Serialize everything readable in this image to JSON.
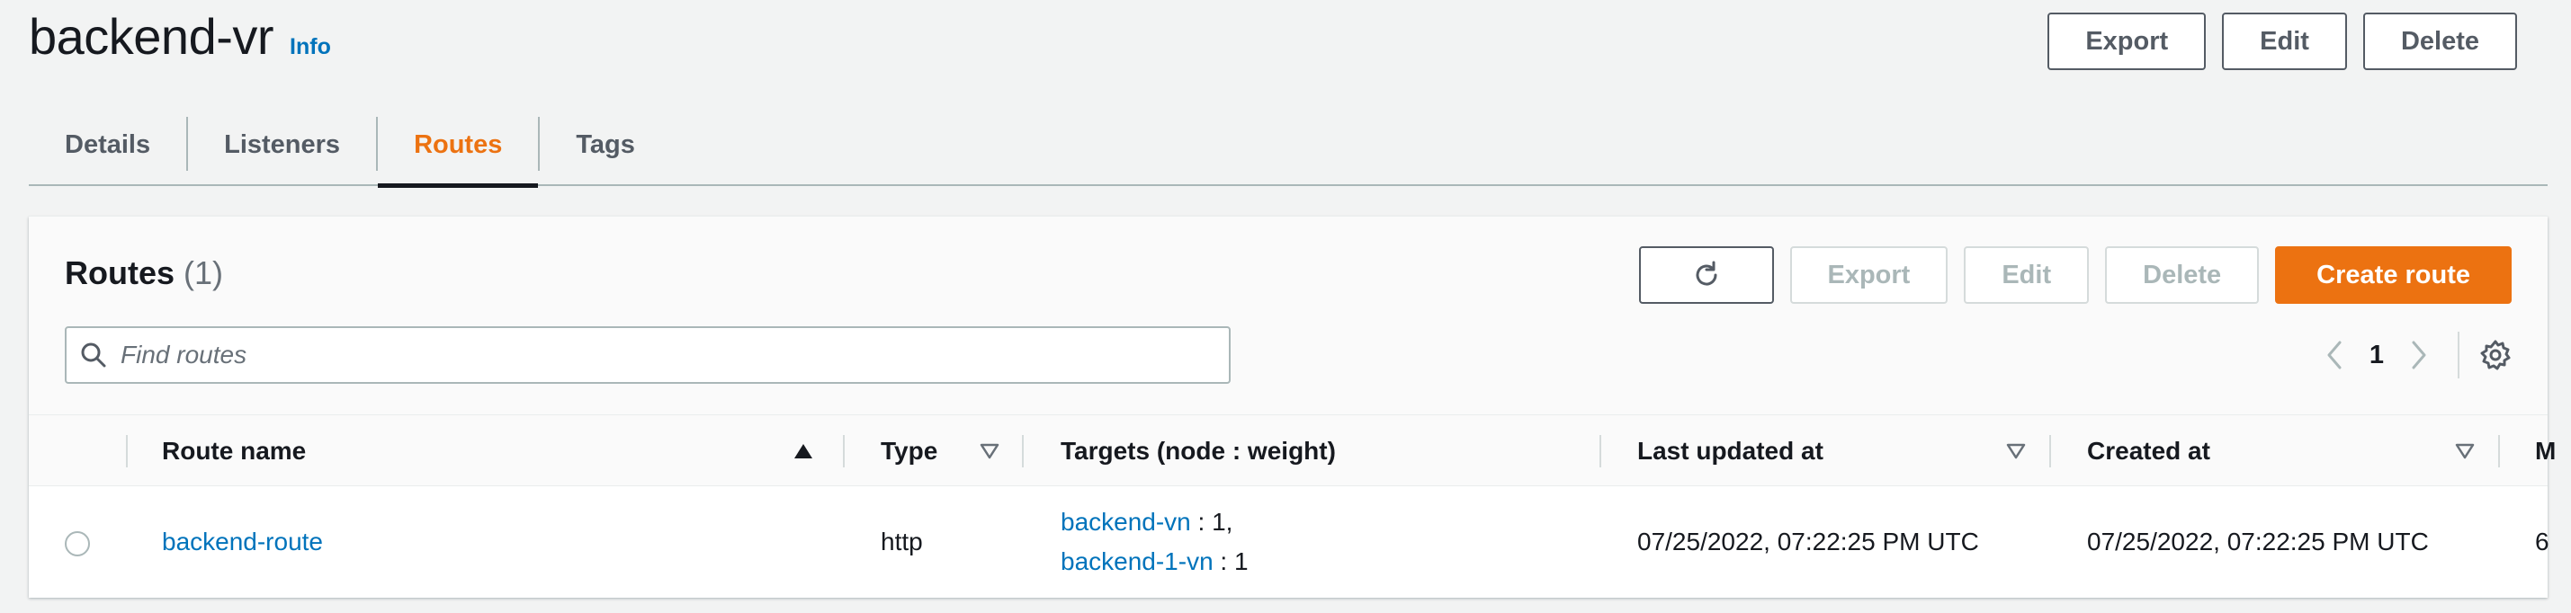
{
  "header": {
    "title": "backend-vr",
    "info_label": "Info",
    "actions": {
      "export": "Export",
      "edit": "Edit",
      "delete": "Delete"
    }
  },
  "tabs": [
    {
      "label": "Details",
      "active": false
    },
    {
      "label": "Listeners",
      "active": false
    },
    {
      "label": "Routes",
      "active": true
    },
    {
      "label": "Tags",
      "active": false
    }
  ],
  "routes_panel": {
    "title": "Routes",
    "count": "(1)",
    "actions": {
      "refresh_icon": "refresh-icon",
      "export": "Export",
      "edit": "Edit",
      "delete": "Delete",
      "create": "Create route"
    },
    "search": {
      "placeholder": "Find routes",
      "value": ""
    },
    "pagination": {
      "current_page": "1"
    },
    "columns": [
      {
        "label": "Route name",
        "sort": "ascending"
      },
      {
        "label": "Type",
        "sort": "none"
      },
      {
        "label": "Targets (node : weight)",
        "sort": null
      },
      {
        "label": "Last updated at",
        "sort": "none"
      },
      {
        "label": "Created at",
        "sort": "none"
      },
      {
        "label": "M",
        "sort": null
      }
    ],
    "rows": [
      {
        "selected": false,
        "route_name": "backend-route",
        "type": "http",
        "targets": [
          {
            "node": "backend-vn",
            "weight": " : 1,"
          },
          {
            "node": "backend-1-vn",
            "weight": " : 1"
          }
        ],
        "last_updated_at": "07/25/2022, 07:22:25 PM UTC",
        "created_at": "07/25/2022, 07:22:25 PM UTC",
        "truncated": "6"
      }
    ]
  },
  "colors": {
    "accent": "#ec7211",
    "link": "#0073bb",
    "text": "#16191f",
    "muted": "#687078",
    "disabled": "#aab7b8"
  }
}
